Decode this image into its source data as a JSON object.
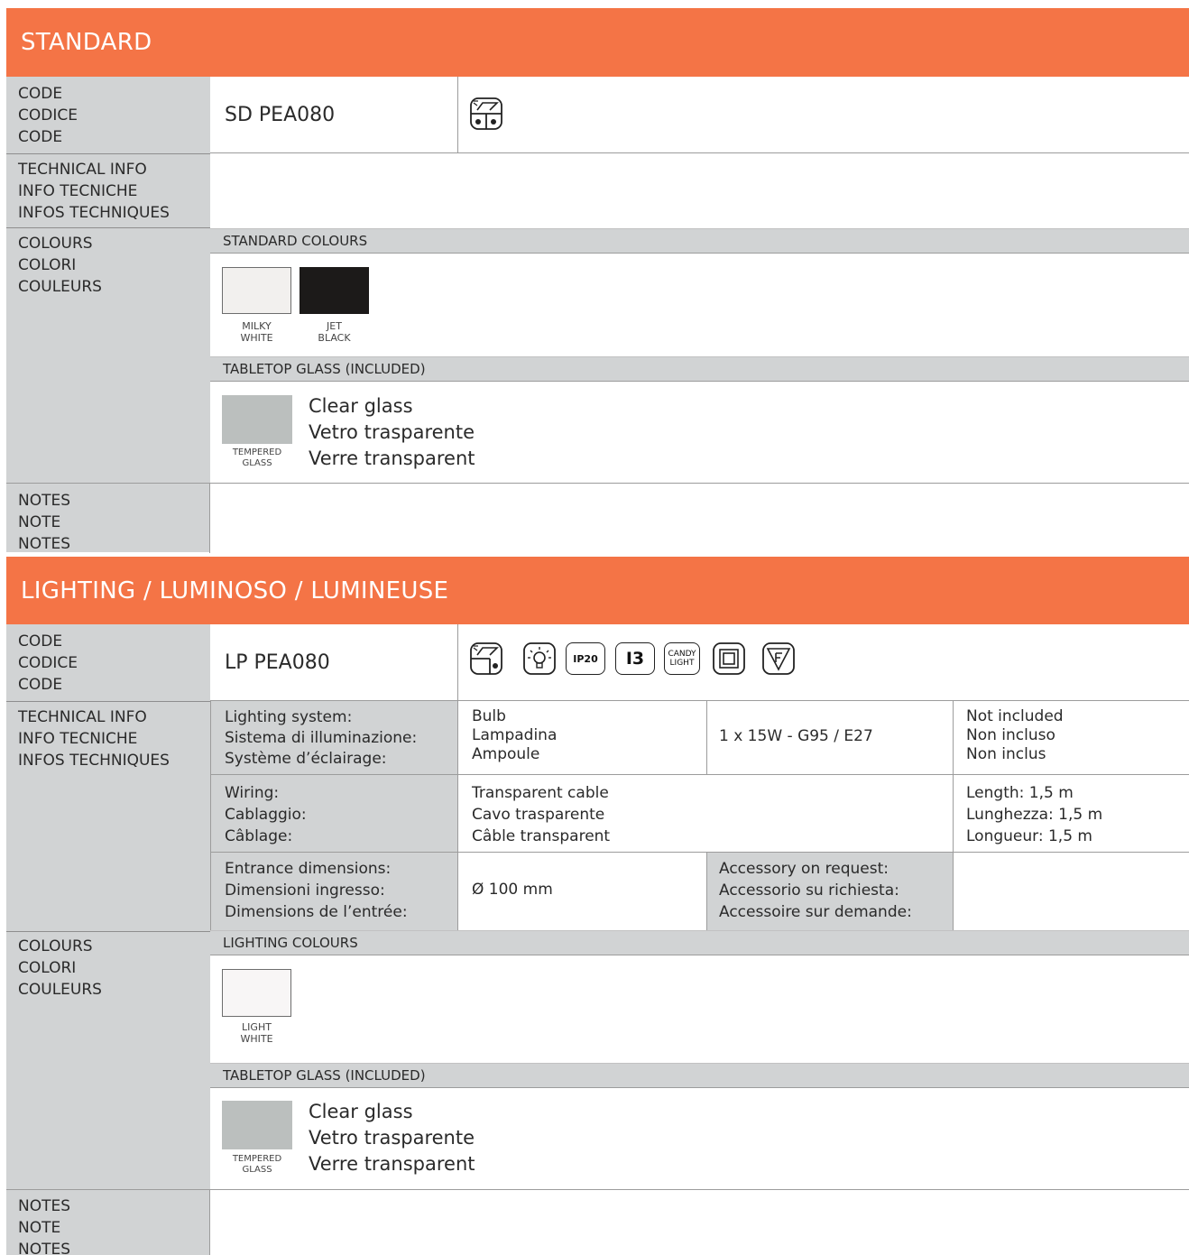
{
  "standard": {
    "header": "STANDARD",
    "code_label": [
      "CODE",
      "CODICE",
      "CODE"
    ],
    "code_value": "SD PEA080",
    "icons": [
      "table-lamp-icon"
    ],
    "tech_label": [
      "TECHNICAL INFO",
      "INFO TECNICHE",
      "INFOS TECHNIQUES"
    ],
    "colours_label": [
      "COLOURS",
      "COLORI",
      "COULEURS"
    ],
    "standard_colours_header": "STANDARD COLOURS",
    "swatches": [
      {
        "name": [
          "MILKY",
          "WHITE"
        ],
        "color": "#f2f0ee"
      },
      {
        "name": [
          "JET",
          "BLACK"
        ],
        "color": "#1c1a19"
      }
    ],
    "glass_header": "TABLETOP GLASS (INCLUDED)",
    "glass_swatch": {
      "name": [
        "TEMPERED",
        "GLASS"
      ],
      "color": "#bbbfbe"
    },
    "glass_text": [
      "Clear glass",
      "Vetro trasparente",
      "Verre transparent"
    ],
    "notes_label": [
      "NOTES",
      "NOTE",
      "NOTES"
    ]
  },
  "lighting": {
    "header": "LIGHTING / LUMINOSO / LUMINEUSE",
    "code_label": [
      "CODE",
      "CODICE",
      "CODE"
    ],
    "code_value": "LP PEA080",
    "icons": [
      "table-lamp-icon",
      "bulb-icon",
      "ip20-icon",
      "i3-icon",
      "candy-light-icon",
      "double-insulation-icon",
      "f-mark-icon"
    ],
    "icon_texts": {
      "ip20": "IP20",
      "i3": "I3",
      "candy": [
        "CANDY",
        "LIGHT"
      ],
      "f": "F"
    },
    "tech_label": [
      "TECHNICAL INFO",
      "INFO TECNICHE",
      "INFOS TECHNIQUES"
    ],
    "tech": {
      "lighting_system_label": [
        "Lighting system:",
        "Sistema di illuminazione:",
        "Système d’éclairage:"
      ],
      "lighting_system_value": [
        "Bulb",
        "Lampadina",
        "Ampoule"
      ],
      "lighting_system_spec": "1 x 15W - G95 / E27",
      "lighting_system_note": [
        "Not included",
        "Non incluso",
        "Non inclus"
      ],
      "wiring_label": [
        "Wiring:",
        "Cablaggio:",
        "Câblage:"
      ],
      "wiring_value": [
        "Transparent cable",
        "Cavo trasparente",
        "Câble transparent"
      ],
      "wiring_length": [
        "Length: 1,5 m",
        "Lunghezza: 1,5 m",
        "Longueur: 1,5 m"
      ],
      "entrance_label": [
        "Entrance dimensions:",
        "Dimensioni ingresso:",
        "Dimensions de l’entrée:"
      ],
      "entrance_value": "Ø 100 mm",
      "accessory_label": [
        "Accessory on request:",
        "Accessorio su richiesta:",
        "Accessoire sur demande:"
      ]
    },
    "colours_label": [
      "COLOURS",
      "COLORI",
      "COULEURS"
    ],
    "lighting_colours_header": "LIGHTING COLOURS",
    "swatches": [
      {
        "name": [
          "LIGHT",
          "WHITE"
        ],
        "color": "#f8f6f6"
      }
    ],
    "glass_header": "TABLETOP GLASS (INCLUDED)",
    "glass_swatch": {
      "name": [
        "TEMPERED",
        "GLASS"
      ],
      "color": "#bbbfbe"
    },
    "glass_text": [
      "Clear glass",
      "Vetro trasparente",
      "Verre transparent"
    ],
    "notes_label": [
      "NOTES",
      "NOTE",
      "NOTES"
    ]
  }
}
